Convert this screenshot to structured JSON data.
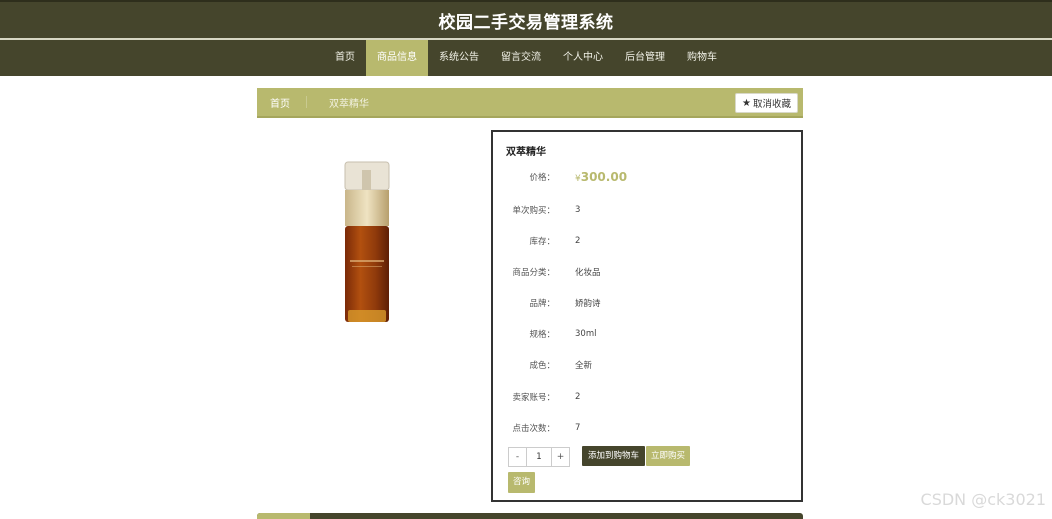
{
  "header": {
    "title": "校园二手交易管理系统"
  },
  "nav": {
    "items": [
      "首页",
      "商品信息",
      "系统公告",
      "留言交流",
      "个人中心",
      "后台管理",
      "购物车"
    ],
    "active_index": 1
  },
  "breadcrumb": {
    "home": "首页",
    "current": "双萃精华",
    "fav_label": "取消收藏"
  },
  "product": {
    "name": "双萃精华",
    "price_label": "价格：",
    "currency": "¥",
    "price": "300.00",
    "fields": [
      {
        "label": "单次购买：",
        "value": "3"
      },
      {
        "label": "库存：",
        "value": "2"
      },
      {
        "label": "商品分类：",
        "value": "化妆品"
      },
      {
        "label": "品牌：",
        "value": "娇韵诗"
      },
      {
        "label": "规格：",
        "value": "30ml"
      },
      {
        "label": "成色：",
        "value": "全新"
      },
      {
        "label": "卖家账号：",
        "value": "2"
      },
      {
        "label": "点击次数：",
        "value": "7"
      }
    ]
  },
  "actions": {
    "minus": "-",
    "quantity": "1",
    "plus": "+",
    "add_cart": "添加到购物车",
    "buy_now": "立即购买",
    "query": "咨询"
  },
  "watermark": "CSDN @ck3021",
  "colors": {
    "dark": "#45452c",
    "accent": "#b8b96e"
  }
}
